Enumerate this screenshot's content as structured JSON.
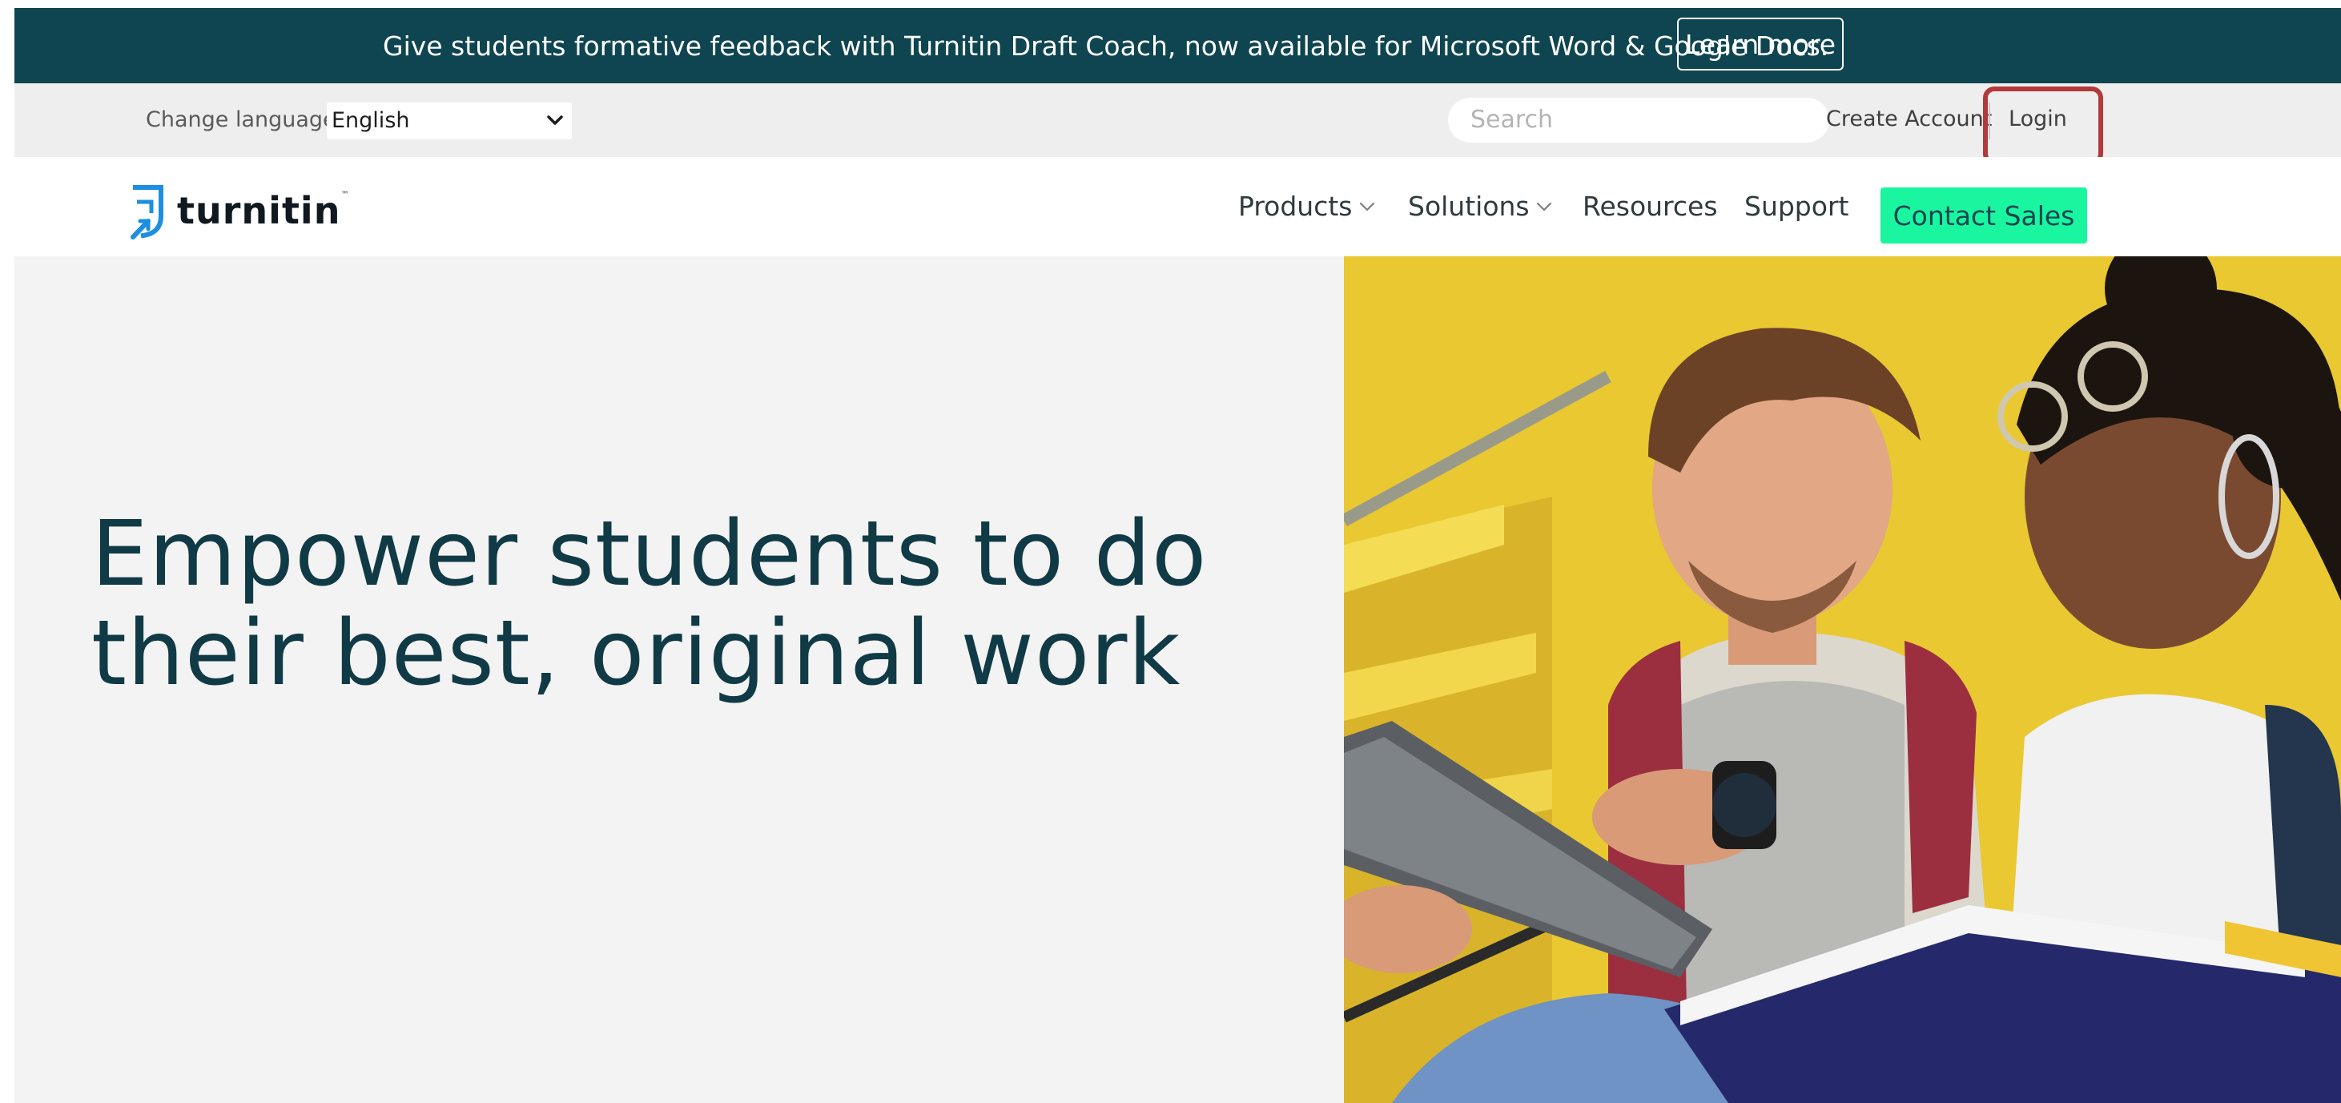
{
  "banner": {
    "text": "Give students formative feedback with Turnitin Draft Coach, now available for Microsoft Word & Google Docs.",
    "button_label": "Learn more"
  },
  "utility": {
    "language_label": "Change language",
    "language_value": "English",
    "search_placeholder": "Search",
    "create_account_label": "Create Account",
    "login_label": "Login"
  },
  "nav": {
    "logo_text": "turnitin",
    "logo_tm": "™",
    "items": [
      {
        "label": "Products"
      },
      {
        "label": "Solutions"
      },
      {
        "label": "Resources"
      },
      {
        "label": "Support"
      }
    ],
    "contact_sales_label": "Contact Sales"
  },
  "hero": {
    "title_line1": "Empower students to do",
    "title_line2": "their best, original work"
  },
  "colors": {
    "banner_bg": "#0f4551",
    "accent_green": "#1af5a0",
    "logo_blue": "#1c8fe0",
    "hero_text": "#103a45",
    "login_highlight": "#b33a3a"
  },
  "icons": {
    "language_select": "chevron-down-icon",
    "products": "chevron-down-icon",
    "solutions": "chevron-down-icon",
    "logo": "turnitin-logo-icon"
  }
}
